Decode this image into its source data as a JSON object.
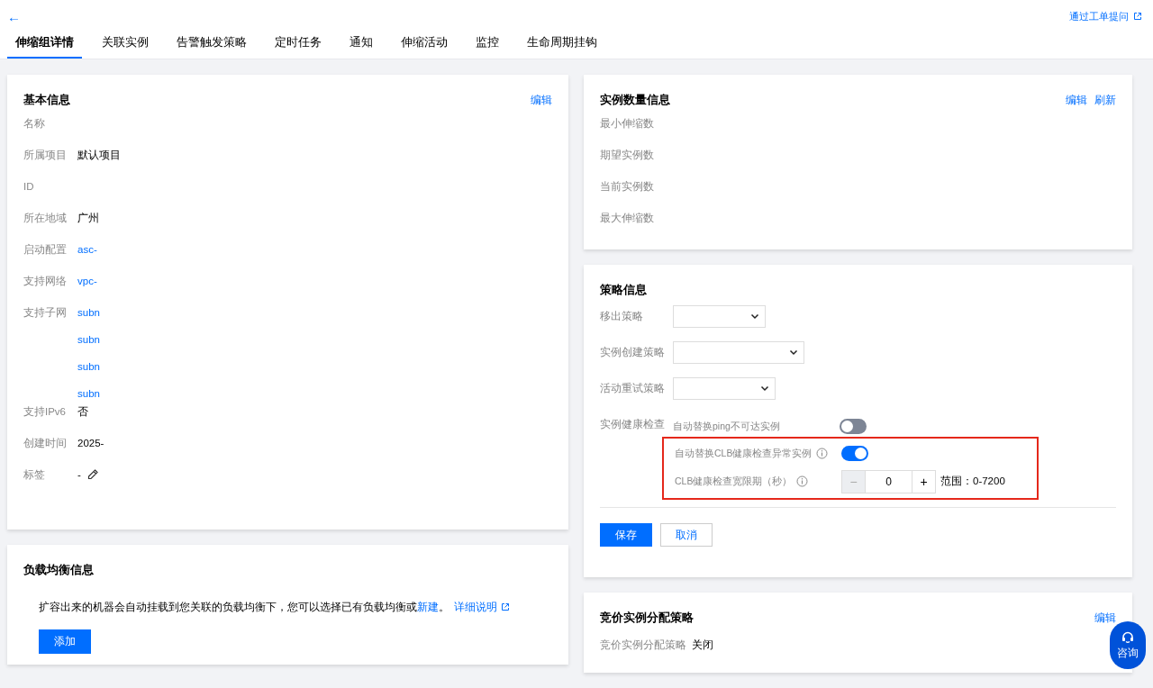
{
  "header": {
    "back": "←",
    "help_link": "通过工单提问"
  },
  "tabs": [
    {
      "label": "伸缩组详情",
      "selected": true
    },
    {
      "label": "关联实例",
      "selected": false
    },
    {
      "label": "告警触发策略",
      "selected": false
    },
    {
      "label": "定时任务",
      "selected": false
    },
    {
      "label": "通知",
      "selected": false
    },
    {
      "label": "伸缩活动",
      "selected": false
    },
    {
      "label": "监控",
      "selected": false
    },
    {
      "label": "生命周期挂钩",
      "selected": false
    }
  ],
  "basic_info": {
    "title": "基本信息",
    "actions": [
      "编辑"
    ],
    "fields": [
      {
        "label": "名称"
      },
      {
        "label": "所属项目",
        "kind": "text",
        "values": [
          "默认项目"
        ]
      },
      {
        "label": "ID"
      },
      {
        "label": "所在地域",
        "kind": "text",
        "values": [
          "广州"
        ]
      },
      {
        "label": "启动配置",
        "kind": "link",
        "values": [
          "asc-"
        ]
      },
      {
        "label": "支持网络",
        "kind": "link",
        "values": [
          "vpc-"
        ]
      },
      {
        "label": "支持子网",
        "kind": "link",
        "values": [
          "subn",
          "subn",
          "subn",
          "subn"
        ]
      },
      {
        "label": "支持IPv6",
        "kind": "text",
        "values": [
          "否"
        ]
      },
      {
        "label": "创建时间",
        "kind": "text",
        "values": [
          "2025-"
        ]
      },
      {
        "label": "标签",
        "kind": "editable",
        "values": [
          "-"
        ]
      }
    ]
  },
  "load_balancer": {
    "title": "负载均衡信息",
    "description": [
      {
        "kind": "text",
        "text": "扩容出来的机器会自动挂载到您关联的负载均衡下，您可以选择已有负载均衡或"
      },
      {
        "kind": "link",
        "text": "新建"
      },
      {
        "kind": "text",
        "text": "。"
      },
      {
        "kind": "external",
        "text": "详细说明"
      }
    ],
    "button": "添加"
  },
  "instance_count": {
    "title": "实例数量信息",
    "actions": [
      "编辑",
      "刷新"
    ],
    "fields": [
      "最小伸缩数",
      "期望实例数",
      "当前实例数",
      "最大伸缩数"
    ]
  },
  "strategy": {
    "title": "策略信息",
    "selects": [
      {
        "label": "移出策略"
      },
      {
        "label": "实例创建策略"
      },
      {
        "label": "活动重试策略"
      }
    ],
    "health_check": {
      "label": "实例健康检查",
      "options": [
        {
          "kind": "toggle",
          "label": "自动替换ping不可达实例",
          "info": false,
          "on": false,
          "highlighted": false
        },
        {
          "kind": "toggle",
          "label": "自动替换CLB健康检查异常实例",
          "info": true,
          "on": true,
          "highlighted": true
        },
        {
          "kind": "stepper",
          "label": "CLB健康检查宽限期（秒）",
          "info": true,
          "minus": "−",
          "value": "0",
          "plus": "+",
          "minus_disabled": true,
          "range": "范围：0-7200",
          "highlighted": true
        }
      ]
    },
    "buttons": [
      {
        "label": "保存",
        "primary": true
      },
      {
        "label": "取消",
        "primary": false
      }
    ]
  },
  "spot": {
    "title": "竞价实例分配策略",
    "actions": [
      "编辑"
    ],
    "fields": [
      {
        "label": "竞价实例分配策略",
        "value": "关闭"
      }
    ]
  },
  "consult": {
    "label": "咨询"
  }
}
